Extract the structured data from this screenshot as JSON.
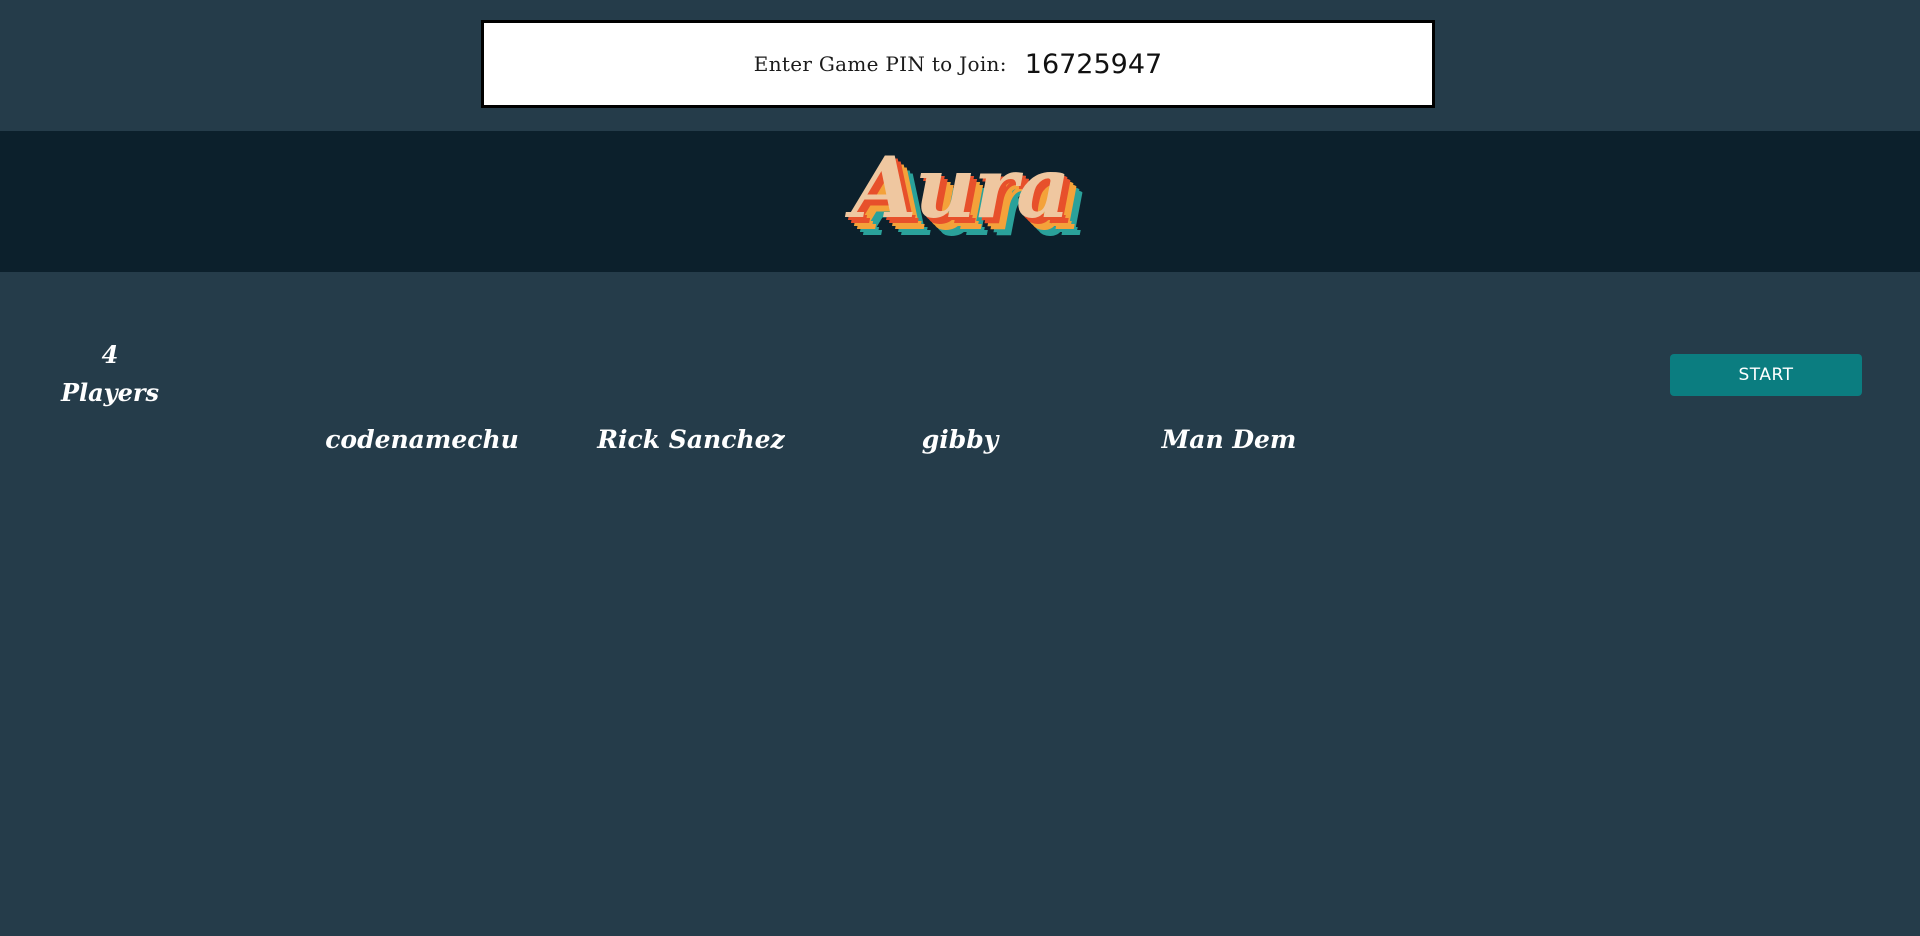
{
  "pin": {
    "label": "Enter Game PIN to Join:",
    "value": "16725947"
  },
  "logo": {
    "text": "Aura"
  },
  "lobby": {
    "count": "4",
    "players_label": "Players",
    "players": [
      "codenamechu",
      "Rick Sanchez",
      "gibby",
      "Man Dem"
    ],
    "start_label": "START"
  },
  "colors": {
    "background": "#253c4a",
    "header": "#0c202c",
    "start_button": "#0b7d80",
    "logo_fill": "#efc7a0",
    "logo_shadow_red": "#e7502b",
    "logo_shadow_orange": "#f4a23a",
    "logo_shadow_teal": "#2aa19a"
  }
}
